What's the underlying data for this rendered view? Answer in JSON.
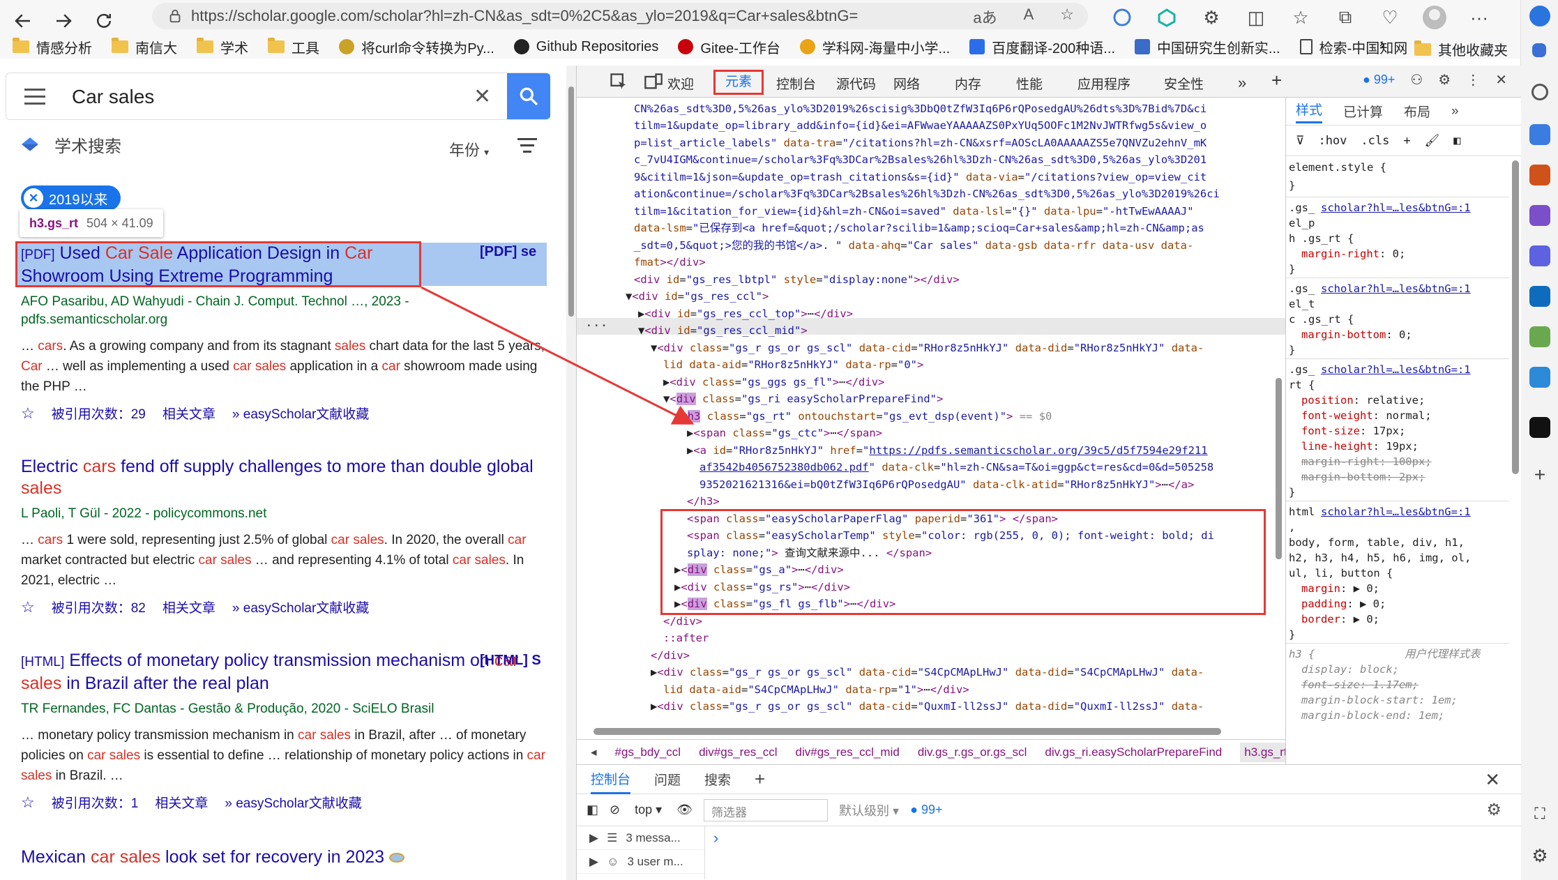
{
  "browser": {
    "url": "https://scholar.google.com/scholar?hl=zh-CN&as_sdt=0%2C5&as_ylo=2019&q=Car+sales&btnG=",
    "url_icons": [
      "aあ",
      "A",
      "☆"
    ],
    "more": "···"
  },
  "bookmarks": [
    {
      "label": "情感分析",
      "type": "folder"
    },
    {
      "label": "南信大",
      "type": "folder"
    },
    {
      "label": "学术",
      "type": "folder"
    },
    {
      "label": "工具",
      "type": "folder"
    },
    {
      "label": "将curl命令转换为Py...",
      "type": "site"
    },
    {
      "label": "Github Repositories",
      "type": "site"
    },
    {
      "label": "Gitee-工作台",
      "type": "site"
    },
    {
      "label": "学科网-海量中小学...",
      "type": "site"
    },
    {
      "label": "百度翻译-200种语...",
      "type": "site"
    },
    {
      "label": "中国研究生创新实...",
      "type": "site"
    },
    {
      "label": "检索-中国知网",
      "type": "site"
    }
  ],
  "bookmarks_other": "其他收藏夹",
  "scholar": {
    "query": "Car sales",
    "brand": "学术搜索",
    "year_filter": "年份",
    "chip": "2019以来",
    "tooltip": {
      "tag": "h3.gs_rt",
      "size": "504 × 41.09"
    },
    "results": [
      {
        "type": "[PDF]",
        "title_parts": [
          "Used ",
          "Car Sale",
          " Application Design in ",
          "Car",
          " Showroom Using Extreme Programming"
        ],
        "side": "[PDF] se",
        "authors_html": "AFO Pasaribu, AD Wahyudi - Chain J. Comput. Technol …, 2023 -",
        "authors_line2": "pdfs.semanticscholar.org",
        "snippet": [
          "… ",
          "cars",
          ". As a growing company and from its stagnant ",
          "sales",
          " chart data for the last 5 years, ",
          "Car",
          " … well as implementing a used ",
          "car sales",
          " application in a ",
          "car",
          " showroom made using the PHP …"
        ],
        "cited": "被引用次数：29",
        "related": "相关文章",
        "easy": "easyScholar文献收藏"
      },
      {
        "title_parts": [
          "Electric ",
          "cars",
          " fend off supply challenges to more than double global ",
          "sales"
        ],
        "authors_html": "L Paoli, T Gül - 2022 - policycommons.net",
        "snippet": [
          "… ",
          "cars",
          " 1 were sold, representing just 2.5% of global ",
          "car sales",
          ". In 2020, the overall ",
          "car",
          " market contracted but electric ",
          "car sales",
          " … and representing 4.1% of total ",
          "car sales",
          ". In 2021, electric …"
        ],
        "cited": "被引用次数：82",
        "related": "相关文章",
        "easy": "easyScholar文献收藏"
      },
      {
        "type": "[HTML]",
        "title_parts": [
          "Effects of monetary policy transmission mechanism on ",
          "car sales",
          " in Brazil after the real plan"
        ],
        "side": "[HTML] S",
        "authors_html": "TR Fernandes, FC Dantas - Gestão & Produção, 2020 - SciELO Brasil",
        "snippet": [
          "… monetary policy transmission mechanism in ",
          "car sales",
          " in Brazil, after … of monetary policies on ",
          "car sales",
          " is essential to define … relationship of monetary policy actions in ",
          "car sales",
          " in Brazil. …"
        ],
        "cited": "被引用次数：1",
        "related": "相关文章",
        "easy": "easyScholar文献收藏"
      },
      {
        "title_parts": [
          "Mexican ",
          "car sales",
          " look set for recovery in 2023"
        ]
      }
    ]
  },
  "devtools": {
    "tabs": [
      "欢迎",
      "元素",
      "控制台",
      "源代码",
      "网络",
      "内存",
      "性能",
      "应用程序",
      "安全性"
    ],
    "issues_badge": "99+",
    "breadcrumbs": [
      "#gs_bdy_ccl",
      "div#gs_res_ccl",
      "div#gs_res_ccl_mid",
      "div.gs_r.gs_or.gs_scl",
      "div.gs_ri.easyScholarPrepareFind",
      "h3.gs_rt"
    ],
    "styles_tabs": [
      "样式",
      "已计算",
      "布局"
    ],
    "styles_toolbar": [
      ":hov",
      ".cls"
    ],
    "drawer_tabs": [
      "控制台",
      "问题",
      "搜索"
    ],
    "console": {
      "context": "top",
      "filter_placeholder": "筛选器",
      "level": "默认级别",
      "badge": "99+",
      "sidebar": [
        "3 messa...",
        "3 user m..."
      ]
    }
  }
}
